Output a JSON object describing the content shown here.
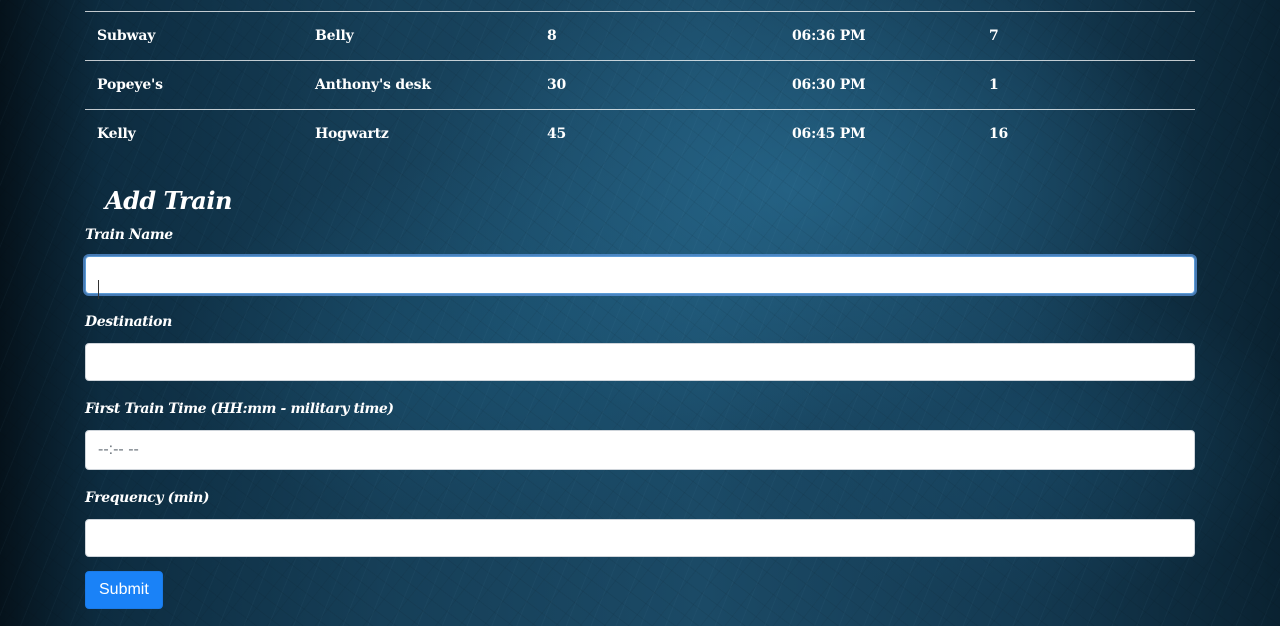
{
  "schedule": {
    "rows": [
      {
        "name": "Subway",
        "destination": "Belly",
        "frequency": "8",
        "next_arrival": "06:36 PM",
        "minutes_away": "7"
      },
      {
        "name": "Popeye's",
        "destination": "Anthony's desk",
        "frequency": "30",
        "next_arrival": "06:30 PM",
        "minutes_away": "1"
      },
      {
        "name": "Kelly",
        "destination": "Hogwartz",
        "frequency": "45",
        "next_arrival": "06:45 PM",
        "minutes_away": "16"
      }
    ]
  },
  "add_train": {
    "title": "Add Train",
    "train_name_label": "Train Name",
    "train_name_value": "",
    "destination_label": "Destination",
    "destination_value": "",
    "first_time_label": "First Train Time (HH:mm - military time)",
    "first_time_placeholder": "--:-- --",
    "frequency_label": "Frequency (min)",
    "frequency_value": "",
    "submit_label": "Submit"
  },
  "colors": {
    "submit_button": "#1a82f7",
    "focus_ring": "#5c9bd6"
  }
}
